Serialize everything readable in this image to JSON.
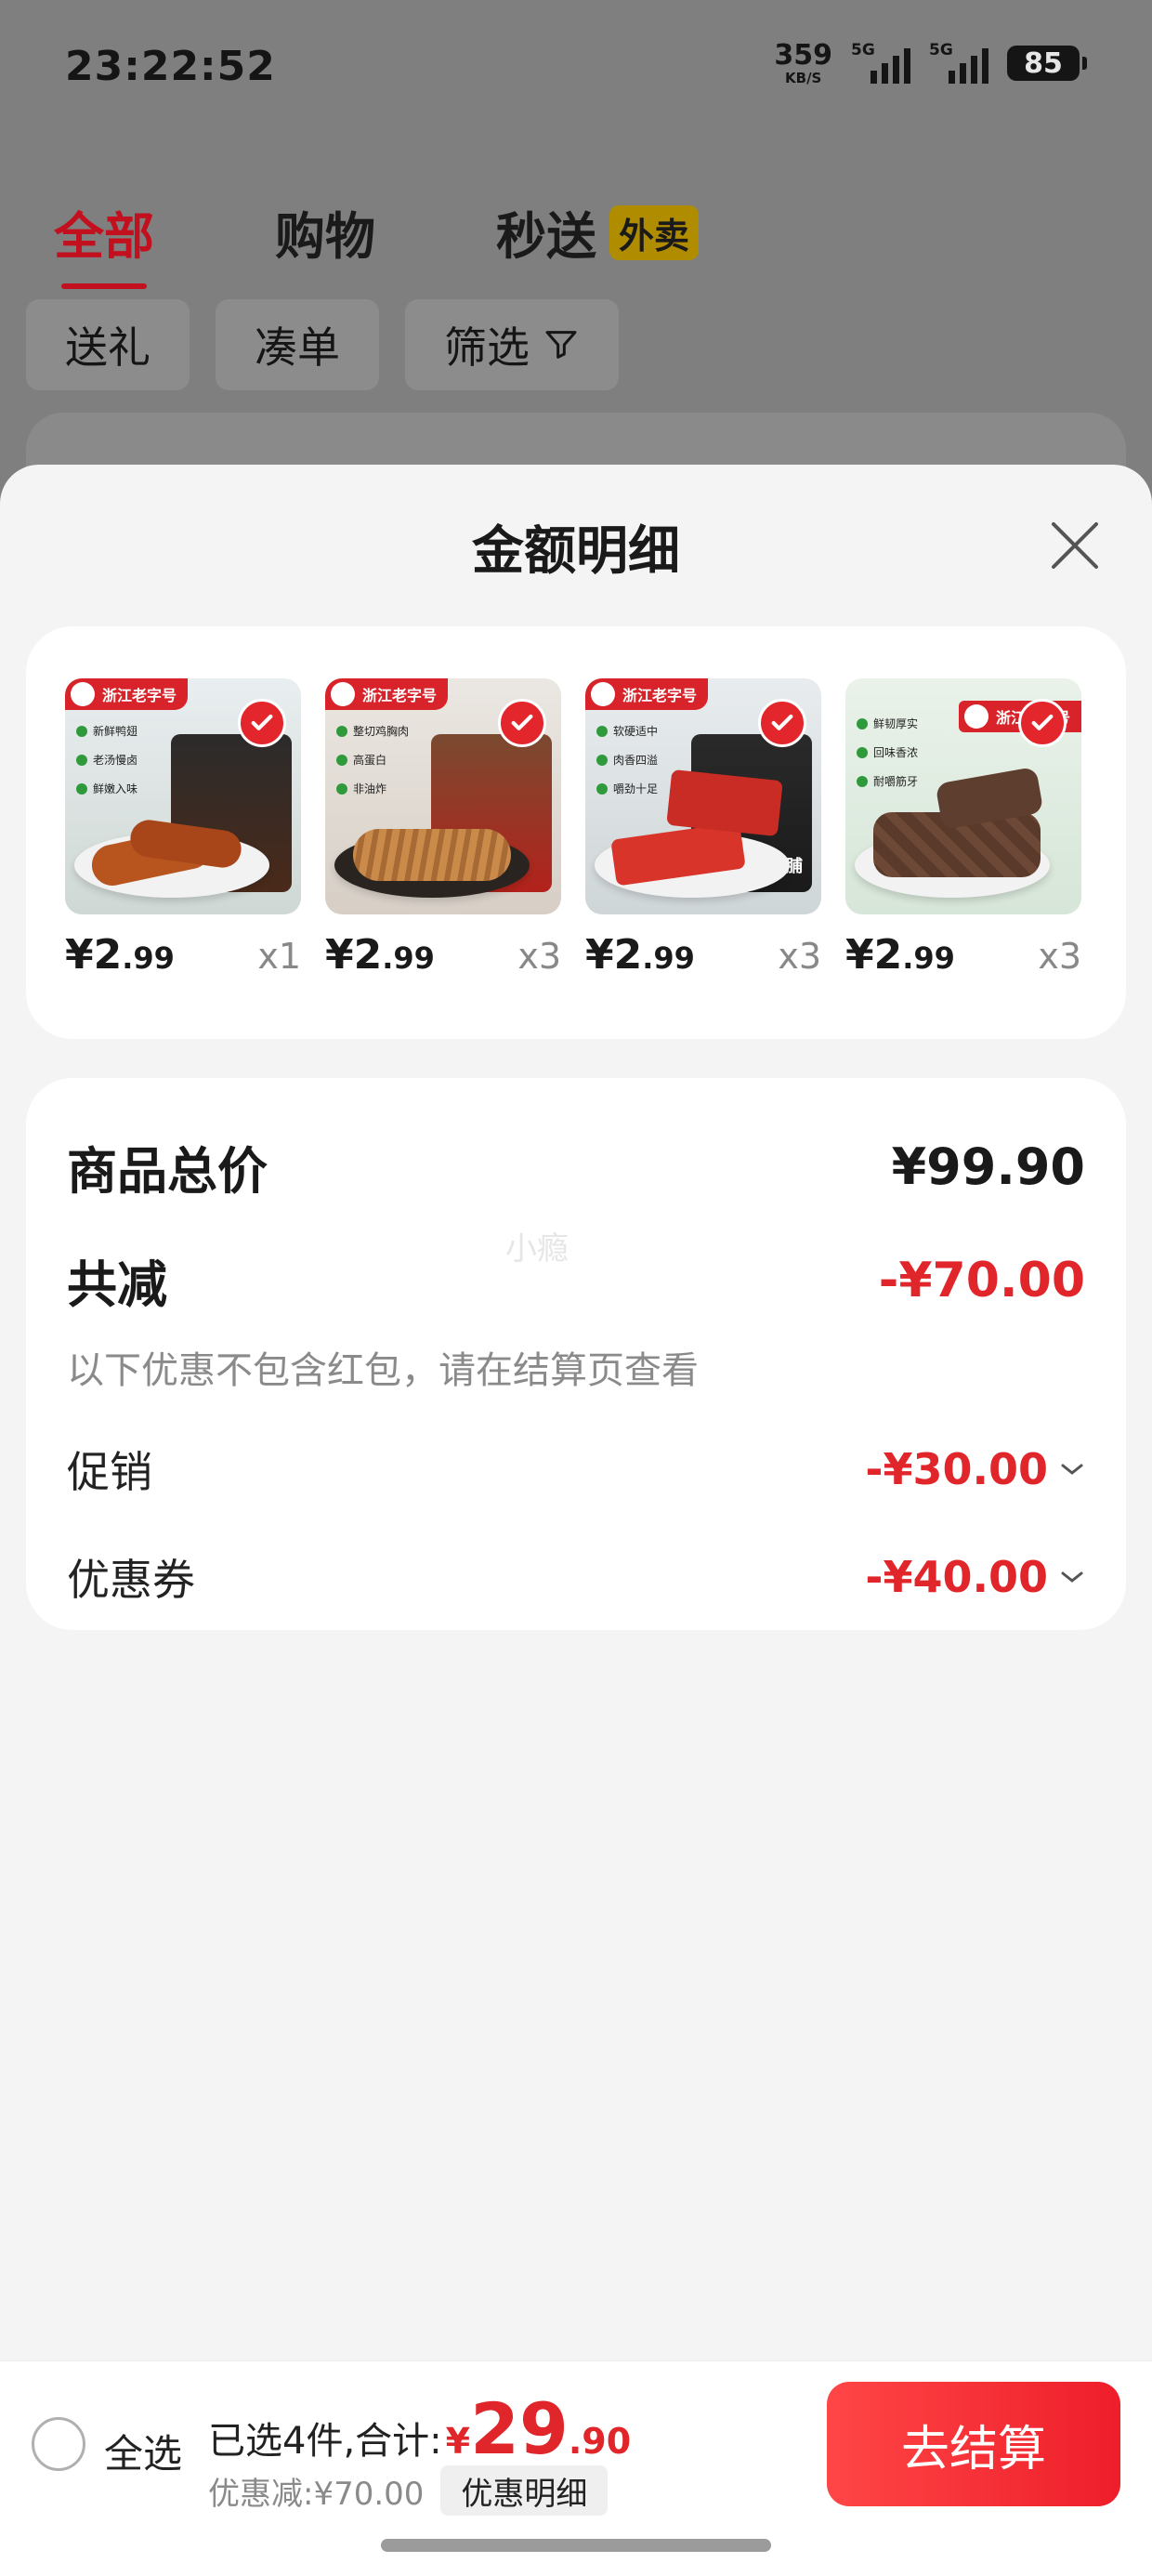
{
  "status_bar": {
    "time": "23:22:52",
    "speed_value": "359",
    "speed_unit": "KB/S",
    "network_1": "5G",
    "network_2": "5G",
    "battery": "85"
  },
  "tabs": [
    {
      "label": "全部",
      "active": true
    },
    {
      "label": "购物",
      "active": false
    },
    {
      "label": "秒送",
      "active": false,
      "badge": "外卖"
    }
  ],
  "chips": [
    "送礼",
    "凑单",
    "筛选"
  ],
  "sheet": {
    "title": "金额明细"
  },
  "items": [
    {
      "brand": "浙江老字号",
      "features": [
        "新鲜鸭翅",
        "老汤慢卤",
        "鲜嫩入味"
      ],
      "price_int": "¥2",
      "price_dec": ".99",
      "qty": "x1"
    },
    {
      "brand": "浙江老字号",
      "features": [
        "整切鸡胸肉",
        "高蛋白",
        "非油炸"
      ],
      "price_int": "¥2",
      "price_dec": ".99",
      "qty": "x3"
    },
    {
      "brand": "浙江老字号",
      "features": [
        "软硬适中",
        "肉香四溢",
        "嚼劲十足"
      ],
      "pkg_label": "猪肉脯",
      "price_int": "¥2",
      "price_dec": ".99",
      "qty": "x3"
    },
    {
      "brand": "浙江老字号",
      "features": [
        "鲜韧厚实",
        "回味香浓",
        "耐嚼筋牙"
      ],
      "price_int": "¥2",
      "price_dec": ".99",
      "qty": "x3"
    }
  ],
  "summary": {
    "total_label": "商品总价",
    "total_value": "¥99.90",
    "watermark": "小瘾",
    "reduce_label": "共减",
    "reduce_value": "-¥70.00",
    "note": "以下优惠不包含红包，请在结算页查看",
    "promo_label": "促销",
    "promo_value": "-¥30.00",
    "coupon_label": "优惠券",
    "coupon_value": "-¥40.00"
  },
  "bottom": {
    "select_all": "全选",
    "selected_text": "已选4件,合计:",
    "yen": "¥",
    "total_int": "29",
    "total_dec": ".90",
    "discount_text": "优惠减:¥70.00",
    "detail_button": "优惠明细",
    "checkout": "去结算"
  },
  "colors": {
    "accent_red": "#e0262a",
    "tab_red": "#c3101f",
    "sheet_bg": "#f4f4f4"
  }
}
